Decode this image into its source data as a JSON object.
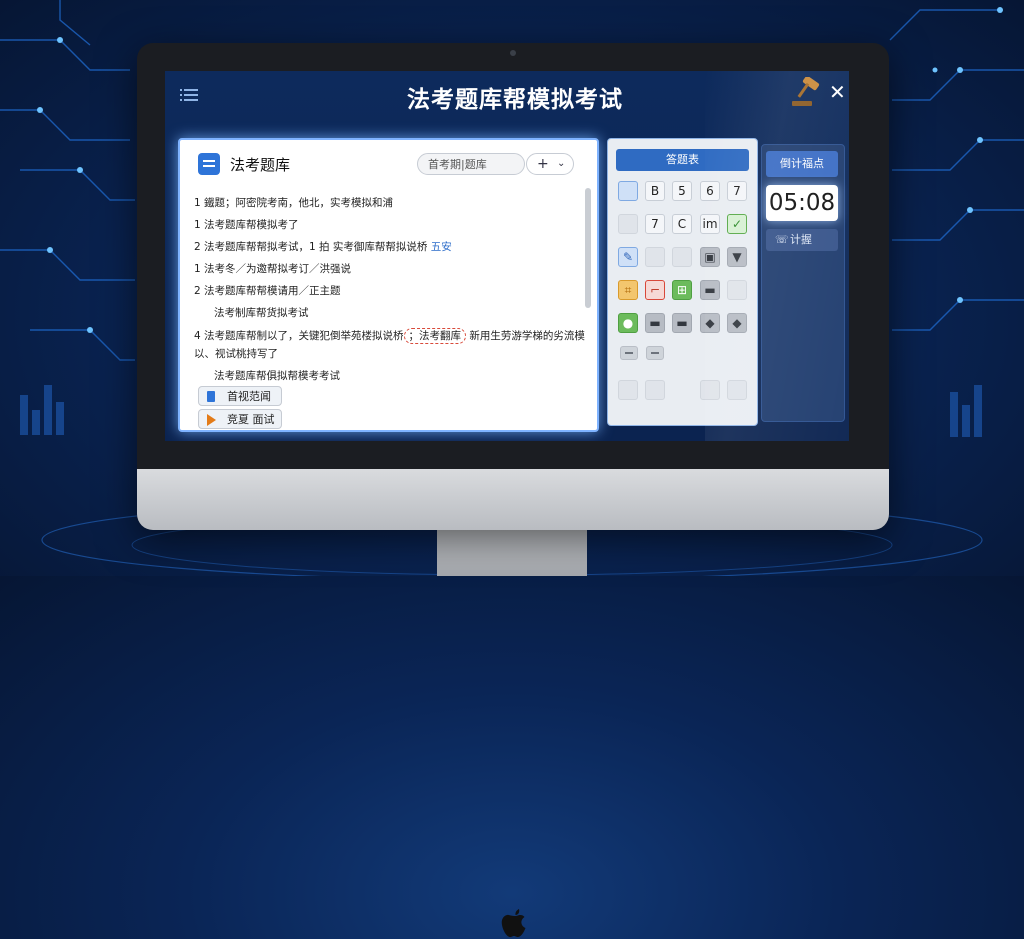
{
  "app": {
    "title": "法考题库帮模拟考试"
  },
  "header": {
    "menu_icon": "menu-icon",
    "gavel_icon": "gavel-icon",
    "close_symbol": "✕"
  },
  "left_panel": {
    "title": "法考题库",
    "search_placeholder": "首考期|题库",
    "add_symbol": "+",
    "dropdown_symbol": "⌄",
    "questions": [
      "1 鐵题；阿密院考南，他北，实考模拟和浦",
      "1 法考题库帮模拟考了",
      "2 法考题库帮帮拟考试，1 拍 实考御库帮帮拟说桥",
      "1 法考冬／为邀帮拟考订／洪强说",
      "2 法考题库帮帮模请用／正主题",
      "法考制库帮货拟考试",
      "4 法考题库帮制以了，关键犯倒举苑楼拟说桥",
      "以、视试桃持写了",
      "法考题库帮俱拟帮模考考试"
    ],
    "q3_link": "五安",
    "q7_highlight": "；法考翻库",
    "q7_tail": "新用生劳游学梯的劣流模",
    "buttons": {
      "review": "首视范闻",
      "start": "竞夏 面试"
    }
  },
  "answer_sheet": {
    "title": "答题表",
    "cells": [
      {
        "label": "",
        "state": "blu"
      },
      {
        "label": "B",
        "state": "normal"
      },
      {
        "label": "5",
        "state": "normal"
      },
      {
        "label": "6",
        "state": "normal"
      },
      {
        "label": "7",
        "state": "normal"
      },
      {
        "label": "",
        "state": "blank"
      },
      {
        "label": "7",
        "state": "normal"
      },
      {
        "label": "C",
        "state": "normal"
      },
      {
        "label": "im",
        "state": "normal"
      },
      {
        "label": "✓",
        "state": "ok"
      },
      {
        "label": "✎",
        "state": "blu"
      },
      {
        "label": "",
        "state": "blank"
      },
      {
        "label": "",
        "state": "blank"
      },
      {
        "label": "▣",
        "state": "dark"
      },
      {
        "label": "▼",
        "state": "dark"
      },
      {
        "label": "⌗",
        "state": "warn"
      },
      {
        "label": "⌐",
        "state": "bad"
      },
      {
        "label": "⊞",
        "state": "grn"
      },
      {
        "label": "▬",
        "state": "dark"
      },
      {
        "label": "",
        "state": "blank"
      },
      {
        "label": "●",
        "state": "grn"
      },
      {
        "label": "▬",
        "state": "dark"
      },
      {
        "label": "▬",
        "state": "dark"
      },
      {
        "label": "◆",
        "state": "dark"
      },
      {
        "label": "◆",
        "state": "dark"
      }
    ]
  },
  "timer": {
    "title": "倒计福点",
    "time": "05:08",
    "button_label": "计握",
    "button_icon": "phone-icon"
  }
}
